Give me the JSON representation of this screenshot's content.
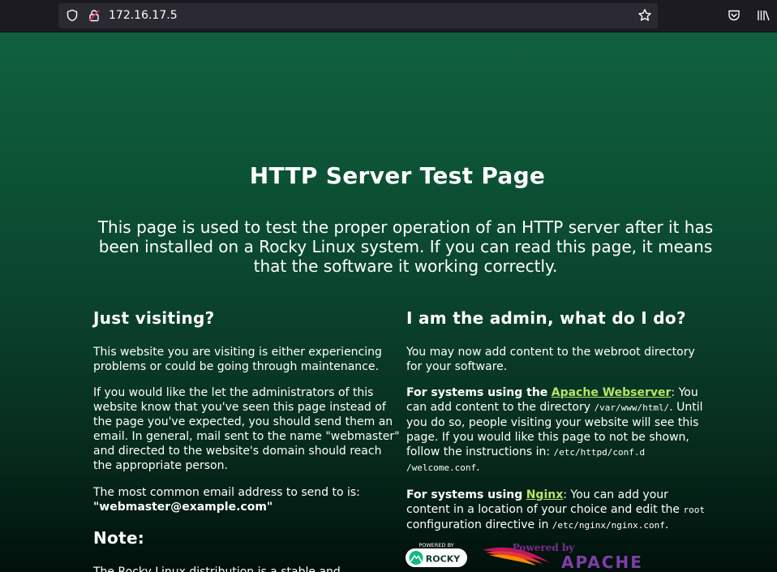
{
  "browser": {
    "url": "172.16.17.5"
  },
  "page": {
    "title": "HTTP Server Test Page",
    "lead": "This page is used to test the proper operation of an HTTP server after it has been installed on a Rocky Linux system. If you can read this page, it means that the software it working correctly.",
    "left": {
      "heading": "Just visiting?",
      "p1": "This website you are visiting is either experiencing problems or could be going through maintenance.",
      "p2": "If you would like the let the administrators of this website know that you've seen this page instead of the page you've expected, you should send them an email. In general, mail sent to the name \"webmaster\" and directed to the website's domain should reach the appropriate person.",
      "p3_text": "The most common email address to send to is:",
      "p3_email": "\"webmaster@example.com\"",
      "note_heading": "Note:",
      "note_text": "The Rocky Linux distribution is a stable and"
    },
    "right": {
      "heading": "I am the admin, what do I do?",
      "p1": "You may now add content to the webroot directory for your software.",
      "apache_prefix": "For systems using the",
      "apache_link": "Apache Webserver",
      "apache_t1": ": You can add content to the directory",
      "apache_dir": "/var/www/html/",
      "apache_t2": ". Until you do so, people visiting your website will see this page. If you would like this page to not be shown, follow the instructions in:",
      "apache_conf": "/etc/httpd/conf.d /welcome.conf",
      "apache_t3": ".",
      "nginx_prefix": "For systems using",
      "nginx_link": "Nginx",
      "nginx_t1": ": You can add your content in a location of your choice and edit the",
      "nginx_root": "root",
      "nginx_t2": "configuration directive in",
      "nginx_conf": "/etc/nginx/nginx.conf",
      "nginx_t3": ".",
      "logo_rocky_top": "POWERED BY",
      "logo_rocky_name": "ROCKY",
      "logo_apache_top": "Powered by",
      "logo_apache_name": "APACHE"
    }
  }
}
